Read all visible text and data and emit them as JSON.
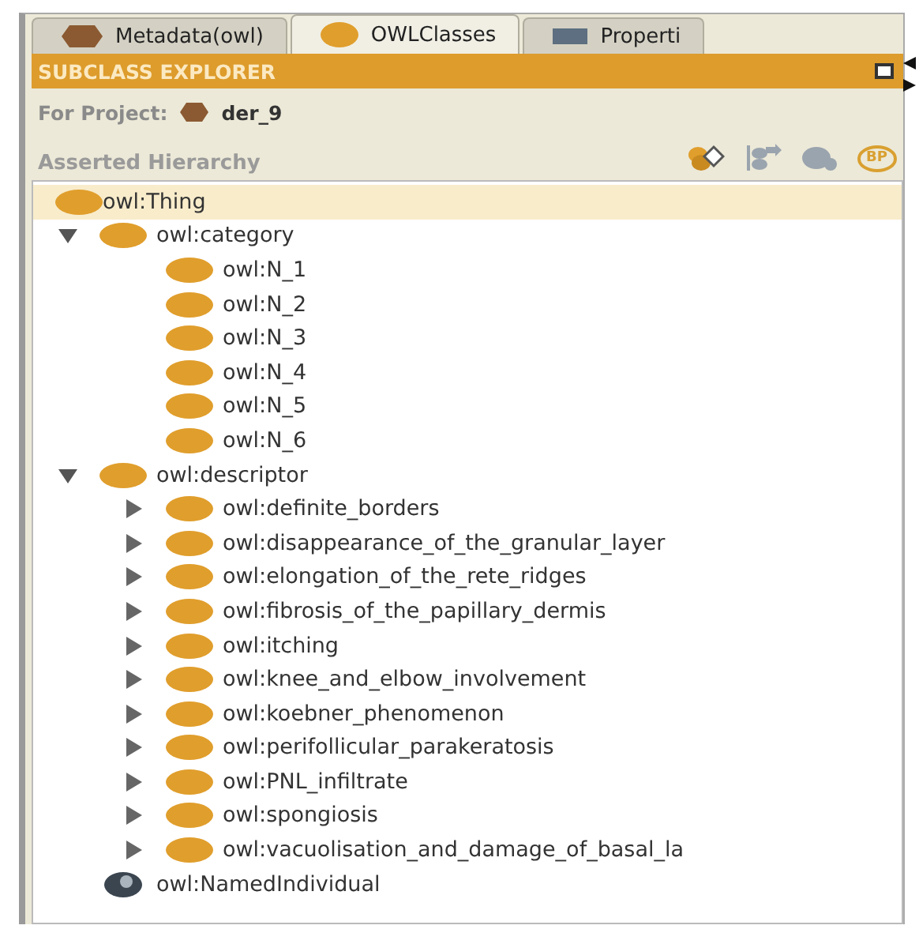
{
  "tabs": [
    {
      "label": "Metadata(owl)",
      "kind": "metadata",
      "selected": false
    },
    {
      "label": "OWLClasses",
      "kind": "classes",
      "selected": true
    },
    {
      "label": "Properti",
      "kind": "properties",
      "selected": false
    }
  ],
  "panel": {
    "title": "SUBCLASS EXPLORER",
    "project_label": "For Project:",
    "project_name": "der_9",
    "hierarchy_label": "Asserted Hierarchy",
    "search_badge": "BP"
  },
  "tree": {
    "label": "owl:Thing",
    "kind": "class",
    "selected": true,
    "children": [
      {
        "label": "owl:category",
        "kind": "class",
        "expanded": true,
        "selected": false,
        "children": [
          {
            "label": "owl:N_1",
            "kind": "class",
            "selected": false
          },
          {
            "label": "owl:N_2",
            "kind": "class",
            "selected": false
          },
          {
            "label": "owl:N_3",
            "kind": "class",
            "selected": false
          },
          {
            "label": "owl:N_4",
            "kind": "class",
            "selected": false
          },
          {
            "label": "owl:N_5",
            "kind": "class",
            "selected": false
          },
          {
            "label": "owl:N_6",
            "kind": "class",
            "selected": false
          }
        ]
      },
      {
        "label": "owl:descriptor",
        "kind": "class",
        "expanded": true,
        "selected": false,
        "children": [
          {
            "label": "owl:definite_borders",
            "kind": "class",
            "expanded": false,
            "selected": false
          },
          {
            "label": "owl:disappearance_of_the_granular_layer",
            "kind": "class",
            "expanded": false,
            "selected": false
          },
          {
            "label": "owl:elongation_of_the_rete_ridges",
            "kind": "class",
            "expanded": false,
            "selected": false
          },
          {
            "label": "owl:fibrosis_of_the_papillary_dermis",
            "kind": "class",
            "expanded": false,
            "selected": false
          },
          {
            "label": "owl:itching",
            "kind": "class",
            "expanded": false,
            "selected": false
          },
          {
            "label": "owl:knee_and_elbow_involvement",
            "kind": "class",
            "expanded": false,
            "selected": false
          },
          {
            "label": "owl:koebner_phenomenon",
            "kind": "class",
            "expanded": false,
            "selected": false
          },
          {
            "label": "owl:perifollicular_parakeratosis",
            "kind": "class",
            "expanded": false,
            "selected": false
          },
          {
            "label": "owl:PNL_infiltrate",
            "kind": "class",
            "expanded": false,
            "selected": false
          },
          {
            "label": "owl:spongiosis",
            "kind": "class",
            "expanded": false,
            "selected": false
          },
          {
            "label": "owl:vacuolisation_and_damage_of_basal_la",
            "kind": "class",
            "expanded": false,
            "selected": false
          }
        ]
      },
      {
        "label": "owl:NamedIndividual",
        "kind": "individual",
        "selected": false
      }
    ]
  }
}
